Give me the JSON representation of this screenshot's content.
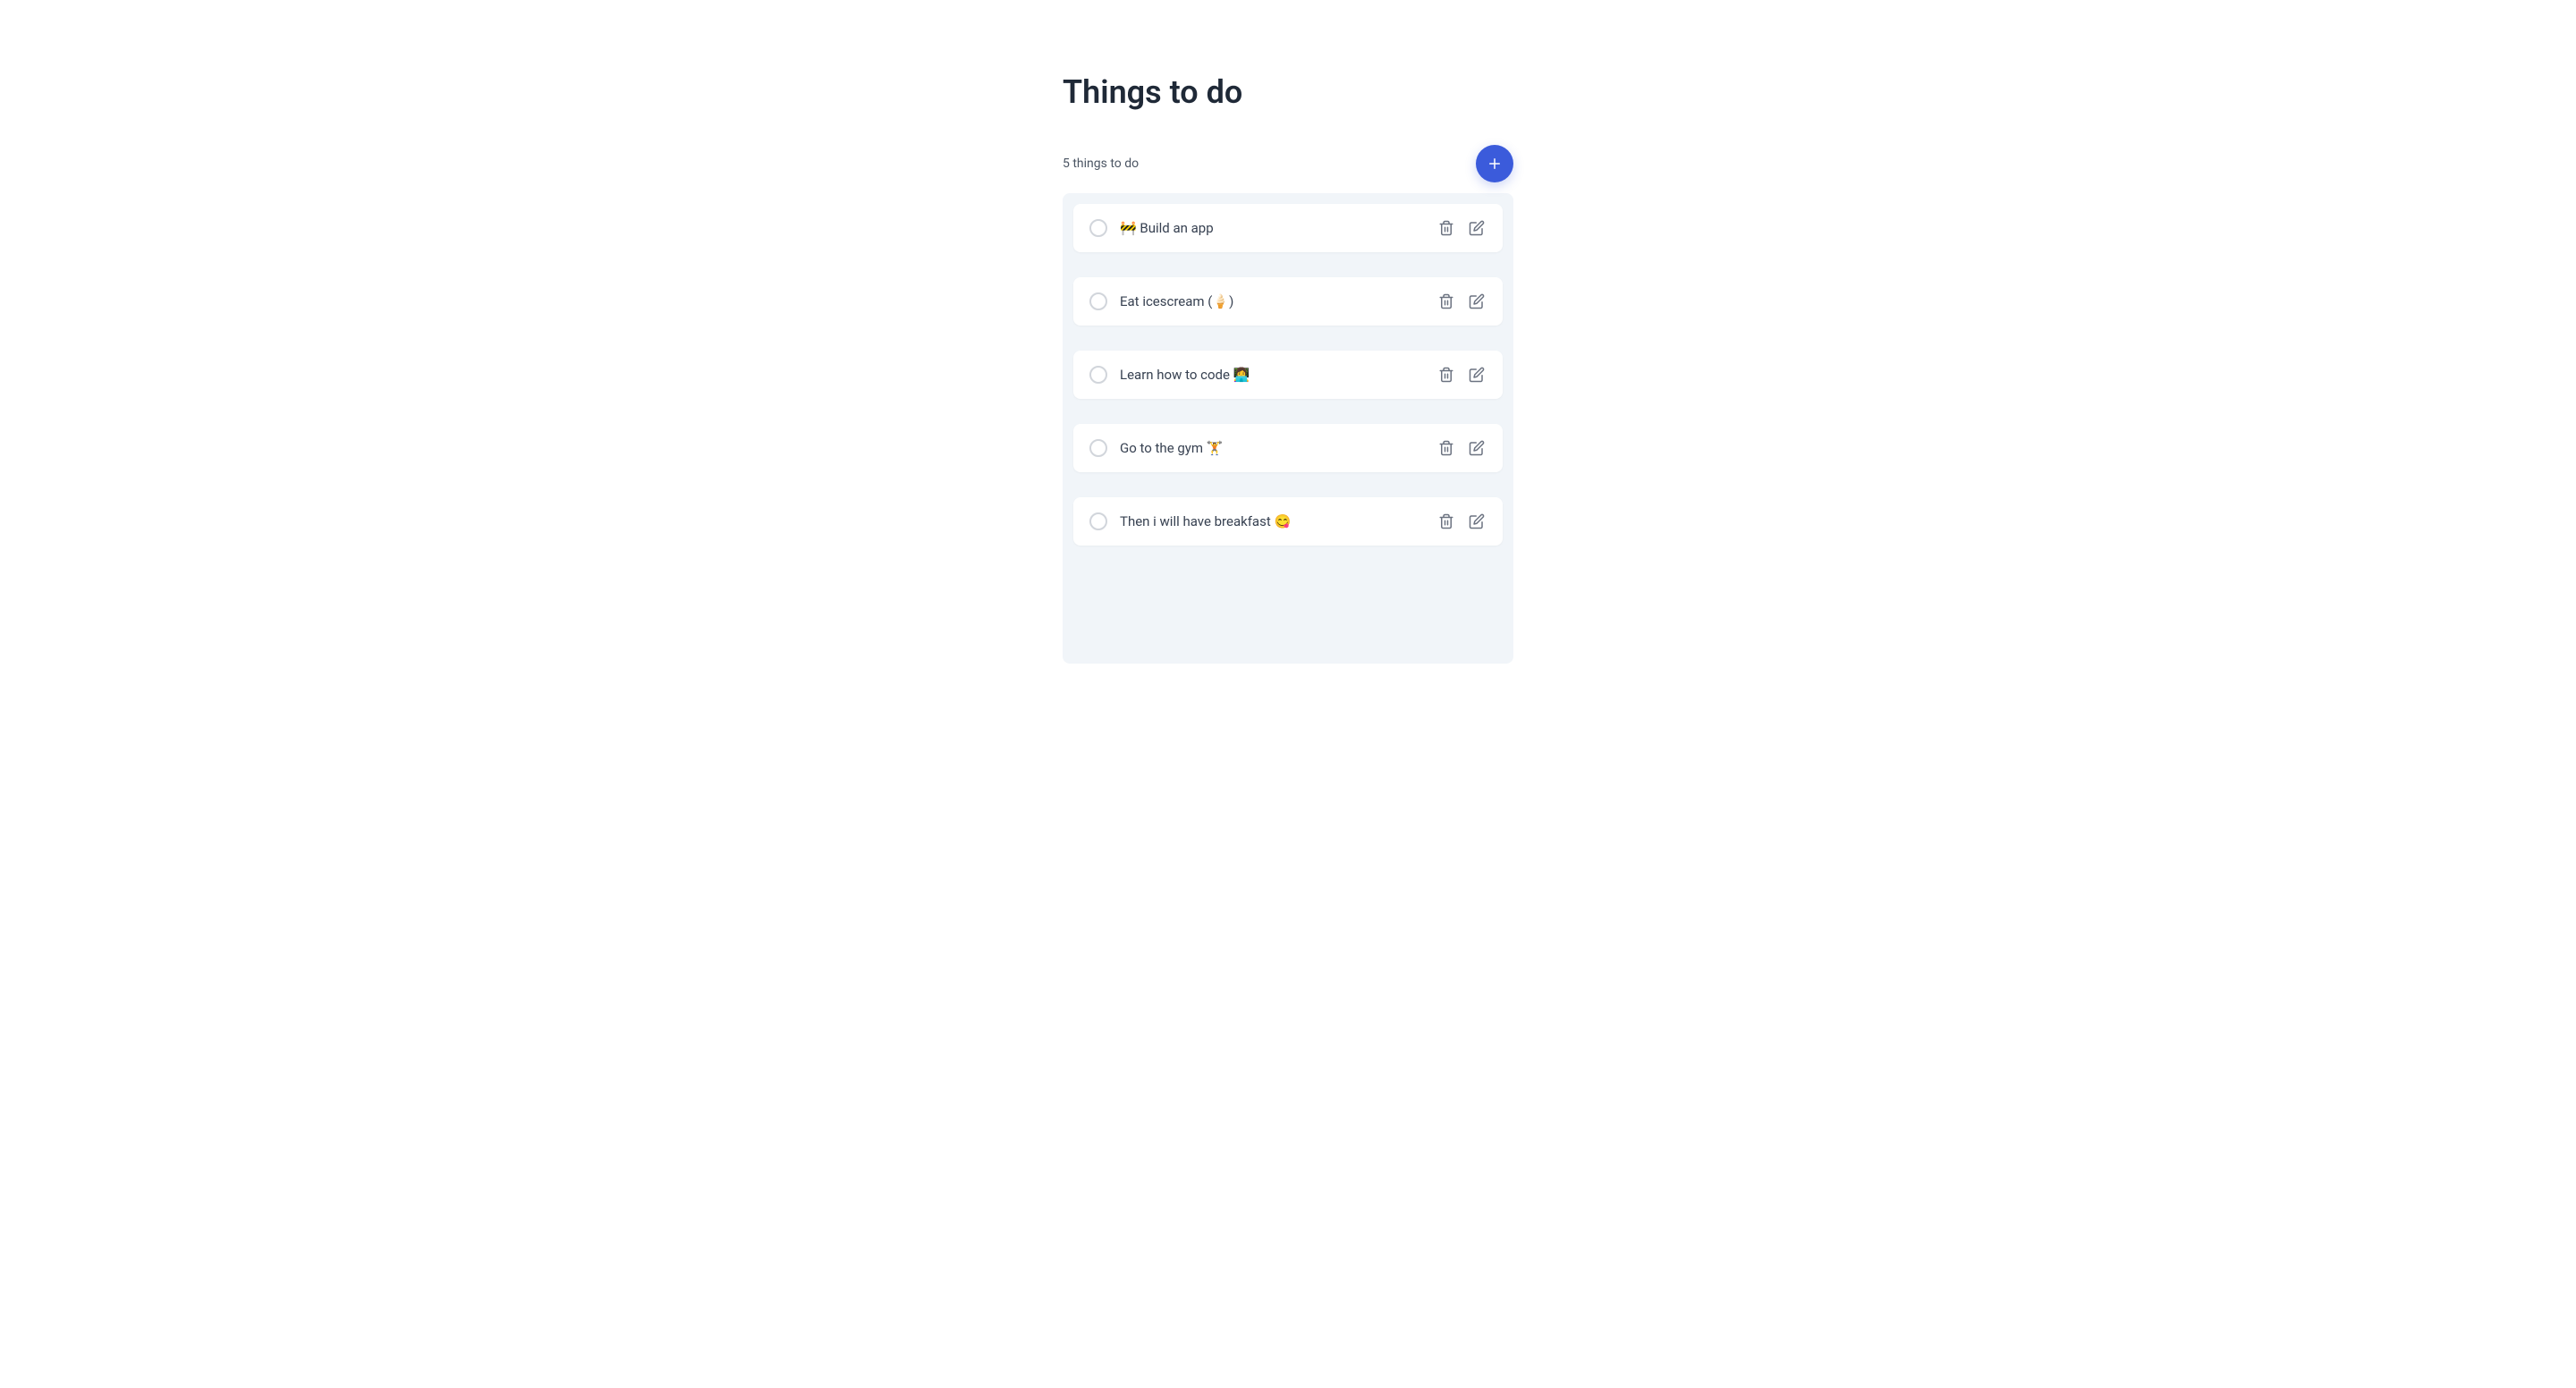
{
  "title": "Things to do",
  "count_text": "5 things to do",
  "items": [
    {
      "text": "🚧 Build an app"
    },
    {
      "text": "Eat icescream (🍦)"
    },
    {
      "text": "Learn how to code 👩‍💻"
    },
    {
      "text": "Go to the gym 🏋️"
    },
    {
      "text": "Then i will have breakfast 😋"
    }
  ]
}
